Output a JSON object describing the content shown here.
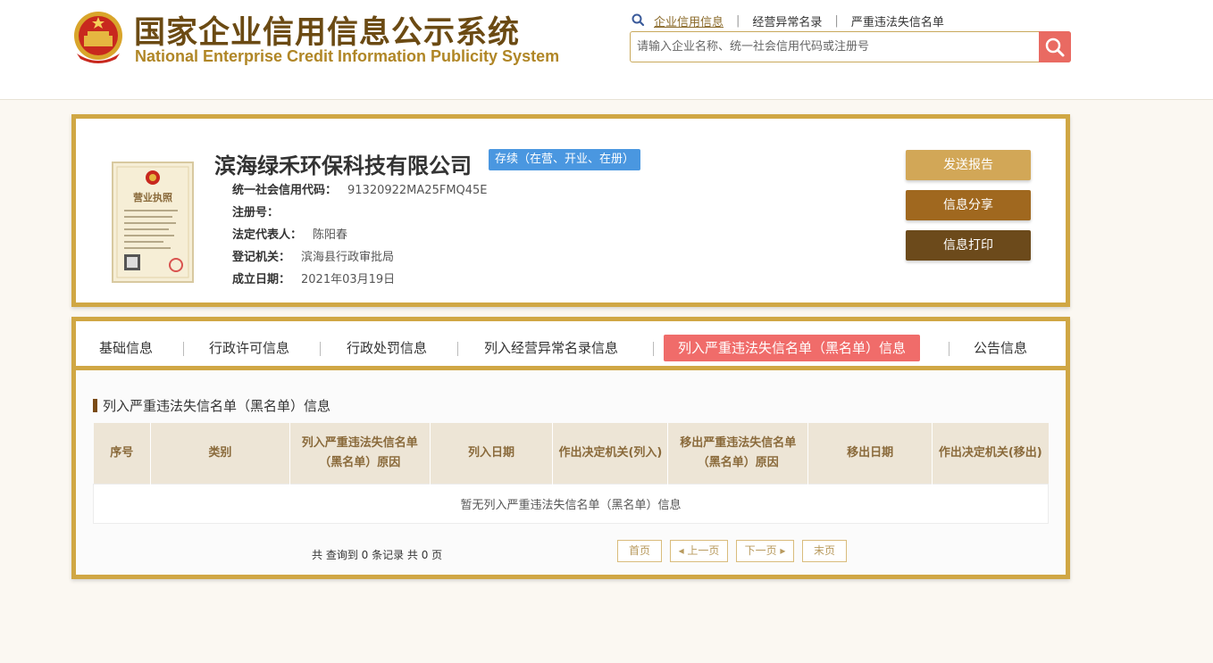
{
  "header": {
    "title_cn": "国家企业信用信息公示系统",
    "title_en": "National Enterprise Credit Information Publicity System",
    "links": [
      "企业信用信息",
      "经营异常名录",
      "严重违法失信名单"
    ],
    "search_placeholder": "请输入企业名称、统一社会信用代码或注册号"
  },
  "company": {
    "license_caption": "营业执照",
    "name": "滨海绿禾环保科技有限公司",
    "status": "存续（在营、开业、在册）",
    "fields": [
      {
        "label": "统一社会信用代码：",
        "value": "91320922MA25FMQ45E"
      },
      {
        "label": "注册号：",
        "value": ""
      },
      {
        "label": "法定代表人：",
        "value": "陈阳春"
      },
      {
        "label": "登记机关：",
        "value": "滨海县行政审批局"
      },
      {
        "label": "成立日期：",
        "value": "2021年03月19日"
      }
    ],
    "buttons": {
      "report": "发送报告",
      "share": "信息分享",
      "print": "信息打印"
    }
  },
  "tabs": [
    "基础信息",
    "行政许可信息",
    "行政处罚信息",
    "列入经营异常名录信息",
    "列入严重违法失信名单（黑名单）信息",
    "公告信息"
  ],
  "section": {
    "title": "列入严重违法失信名单（黑名单）信息",
    "columns": [
      "序号",
      "类别",
      "列入严重违法失信名单（黑名单）原因",
      "列入日期",
      "作出决定机关(列入)",
      "移出严重违法失信名单（黑名单）原因",
      "移出日期",
      "作出决定机关(移出)"
    ],
    "empty_text": "暂无列入严重违法失信名单（黑名单）信息"
  },
  "pager": {
    "info": "共 查询到 0 条记录 共 0 页",
    "first": "首页",
    "prev": "上一页",
    "next": "下一页",
    "last": "末页"
  },
  "colors": {
    "gold": "#d0a744",
    "brown": "#6b4a13",
    "active_tab": "#f06c6a",
    "status_blue": "#4a97e0"
  }
}
